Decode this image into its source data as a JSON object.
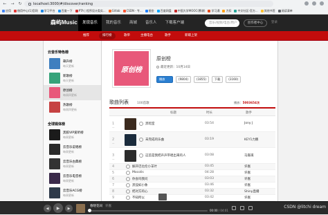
{
  "browser": {
    "url": "localhost:3000/#/discover/ranking",
    "bookmarks": [
      "应用",
      "借用中心(1)官网",
      "学习平台",
      "百度一下",
      "PTA | 程序设计类实...",
      "Gitlab",
      "CSDN - 专...",
      "掘金",
      "百度网盘",
      "中国大学MOOC(慕课)",
      "学习通",
      "力扣",
      "中文社区-官方...",
      "其他书签",
      "阅读清单"
    ]
  },
  "header": {
    "logo": "森屿Music",
    "nav": [
      "发现音乐",
      "我的音乐",
      "商城",
      "音乐人",
      "下载客户端"
    ],
    "nav_active": 0,
    "search_placeholder": "音乐/视频/电台/用户",
    "creator_label": "创作者中心",
    "login_label": "登录"
  },
  "subnav": {
    "items": [
      "推荐",
      "排行榜",
      "歌单",
      "主播电台",
      "歌手",
      "新碟上架"
    ],
    "active": 1
  },
  "sidebar": {
    "section1_title": "云音乐特色榜",
    "section1": [
      {
        "name": "飙升榜",
        "update": "每天更新",
        "color": "#3f7fbf"
      },
      {
        "name": "新歌榜",
        "update": "每天更新",
        "color": "#36a37a"
      },
      {
        "name": "原创榜",
        "update": "每周四更新",
        "color": "#e8587a"
      },
      {
        "name": "热歌榜",
        "update": "每周四更新",
        "color": "#c64242"
      }
    ],
    "section1_active": 2,
    "section2_title": "全球媒体榜",
    "section2": [
      {
        "name": "黑胶VIP爱听榜",
        "update": "每周更新",
        "color": "#1b1b1b"
      },
      {
        "name": "云音乐说唱榜",
        "update": "每周更新",
        "color": "#2a2a2a"
      },
      {
        "name": "云音乐古典榜",
        "update": "每周更新",
        "color": "#333333"
      },
      {
        "name": "云音乐电音榜",
        "update": "每周更新",
        "color": "#3a2a4a"
      },
      {
        "name": "云音乐ACG榜",
        "update": "每周更新",
        "color": "#2e3a4a"
      },
      {
        "name": "云音乐韩语榜",
        "update": "每周更新",
        "color": "#444444"
      }
    ]
  },
  "list": {
    "cover_text": "原创榜",
    "title": "原创榜",
    "updated": "最近更新：10月14日",
    "buttons": {
      "play": "播放",
      "collect": "(9804)",
      "share": "(1855)",
      "download": "下载",
      "comment": "(3160)"
    },
    "songs_heading": "歌曲列表",
    "songs_count": "100首歌",
    "plays_label": "播放：",
    "plays_value": "5003654次",
    "columns": [
      "标题",
      "时长",
      "歌手"
    ]
  },
  "songs": [
    {
      "rank": "1",
      "title": "黑暗室",
      "duration": "03:54",
      "artist": "Jony J",
      "art": "#3b2a1e"
    },
    {
      "rank": "2",
      "title": "未完成的乐曲",
      "duration": "03:19",
      "artist": "KEY1力鹏",
      "art": "#1a2b3c"
    },
    {
      "rank": "3",
      "title": "这首是我把声声带唱出来的人",
      "duration": "03:08",
      "artist": "马嘉祺",
      "art": "#2c2c2c"
    },
    {
      "rank": "4",
      "title": "解开巴比伦小羊叶",
      "duration": "03:45",
      "artist": "许嵩"
    },
    {
      "rank": "5",
      "title": "Mocolis",
      "duration": "04:28",
      "artist": "许嵩"
    },
    {
      "rank": "6",
      "title": "你会吗我问",
      "duration": "03:03",
      "artist": "许嵩"
    },
    {
      "rank": "7",
      "title": "黑弧如小象",
      "duration": "03:46",
      "artist": "许嵩"
    },
    {
      "rank": "8",
      "title": "把对方的心",
      "duration": "03:32",
      "artist": "Shiny直播"
    },
    {
      "rank": "9",
      "title": "不知所以",
      "duration": "03:42",
      "artist": "许嵩"
    }
  ],
  "player": {
    "title": "春晓花间",
    "artist": "许嵩",
    "elapsed": "00:00",
    "total": "04:01",
    "progress": 0
  },
  "watermark": "CSDN @litchi dream"
}
